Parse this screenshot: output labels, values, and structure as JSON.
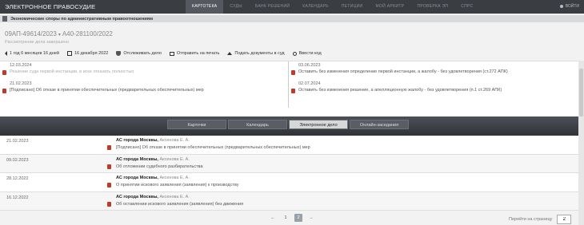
{
  "app": {
    "logo": "ЭЛЕКТРОННОЕ ПРАВОСУДИЕ",
    "nav": [
      "КАРТОТЕКА",
      "СУДЫ",
      "БАНК РЕШЕНИЙ",
      "КАЛЕНДАРЬ",
      "ПЕТИЦИИ",
      "МОЙ АРБИТР",
      "ПРОВЕРКА ЭП",
      "СПРС"
    ],
    "user_label": "ВОЙТИ"
  },
  "category": "Экономические споры по административным правоотношениям",
  "case": {
    "number_primary": "09АП-49614/2023",
    "number_secondary": "А40-281100/2022",
    "status": "Рассмотрение дела завершено"
  },
  "toolbar": [
    {
      "icon": "back-icon",
      "label": "1 год 6 месяцев 16 дней"
    },
    {
      "icon": "calendar-icon",
      "label": "16 декабря 2022"
    },
    {
      "icon": "shield-icon",
      "label": "Отслеживать дело"
    },
    {
      "icon": "print-icon",
      "label": "Отправить на печать"
    },
    {
      "icon": "upload-icon",
      "label": "Подать документы в суд"
    },
    {
      "icon": "key-icon",
      "label": "Ввести код"
    }
  ],
  "instances": {
    "left": [
      {
        "date": "12.03.2024",
        "desc": "Решение суда первой инстанции, в иске отказать полностью",
        "muted": true
      },
      {
        "date": "21.02.2023",
        "desc": "[Подписано] Об отказе в принятии обеспечительных (предварительных обеспечительных) мер",
        "muted": false
      }
    ],
    "right": [
      {
        "date": "03.06.2023",
        "desc": "Оставить без изменения определение первой инстанции, а жалобу - без удовлетворения (ст.272 АПК)"
      },
      {
        "date": "02.07.2024",
        "desc": "Оставить без изменения решение, а апелляционную жалобу - без удовлетворения (п.1 ст.269 АПК)"
      }
    ]
  },
  "tabs": [
    "Карточки",
    "Календарь",
    "Электронное дело",
    "Онлайн-заседания"
  ],
  "active_tab": "Электронное дело",
  "documents": [
    {
      "date": "21.02.2023",
      "court": "АС города Москвы,",
      "judge": " Аксенова Е. А.",
      "desc": "[Подписано] Об отказе в принятии обеспечительных (предварительных обеспечительных) мер"
    },
    {
      "date": "09.02.2023",
      "court": "АС города Москвы,",
      "judge": " Аксенова Е. А.",
      "desc": "Об отложении судебного разбирательства"
    },
    {
      "date": "28.12.2022",
      "court": "АС города Москвы,",
      "judge": " Аксенова Е. А.",
      "desc": "О принятии искового заявления (заявления) к производству"
    },
    {
      "date": "16.12.2022",
      "court": "АС города Москвы,",
      "judge": " Аксенова Е. А.",
      "desc": "Об оставлении искового заявления (заявления) без движения"
    }
  ],
  "pagination": {
    "prev": "←",
    "pages": [
      "1",
      "2"
    ],
    "current": "2",
    "next": "→",
    "goto_label": "Перейти на страницу",
    "goto_value": "2"
  }
}
